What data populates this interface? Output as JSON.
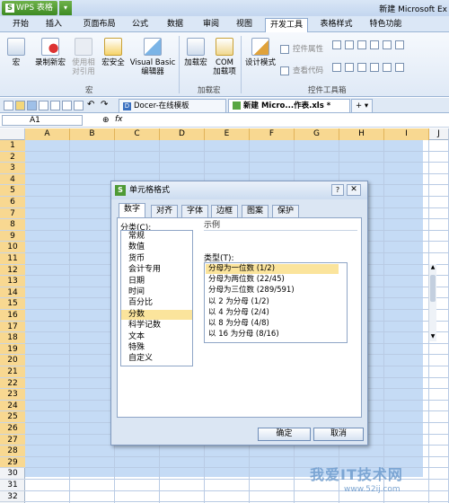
{
  "app": {
    "name": "WPS 表格",
    "logo_letter": "S",
    "window_title": "新建 Microsoft Ex"
  },
  "menu": [
    "开始",
    "插入",
    "页面布局",
    "公式",
    "数据",
    "审阅",
    "视图",
    "开发工具",
    "表格样式",
    "特色功能"
  ],
  "ribbon": {
    "buttons": [
      "宏",
      "录制新宏",
      "使用相\n对引用",
      "宏安全",
      "Visual Basic\n编辑器",
      "加载宏",
      "COM\n加载项",
      "设计模式"
    ],
    "small": [
      "控件属性",
      "查看代码"
    ],
    "groups": [
      "宏",
      "加载宏",
      "控件工具箱"
    ]
  },
  "doc_tabs": [
    "Docer-在线模板",
    "新建 Micro...作表.xls *"
  ],
  "formula_bar": {
    "cell_ref": "A1",
    "fx": "fx"
  },
  "columns": [
    "A",
    "B",
    "C",
    "D",
    "E",
    "F",
    "G",
    "H",
    "I",
    "J"
  ],
  "rows": [
    "1",
    "2",
    "3",
    "4",
    "5",
    "6",
    "7",
    "8",
    "9",
    "10",
    "11",
    "12",
    "13",
    "14",
    "15",
    "16",
    "17",
    "18",
    "19",
    "20",
    "21",
    "22",
    "23",
    "24",
    "25",
    "26",
    "27",
    "28",
    "29",
    "30",
    "31",
    "32"
  ],
  "dialog": {
    "title": "单元格格式",
    "icon_letter": "S",
    "help": "?",
    "close": "✕",
    "tabs": [
      "数字",
      "对齐",
      "字体",
      "边框",
      "图案",
      "保护"
    ],
    "category_label": "分类(C):",
    "categories": [
      "常规",
      "数值",
      "货币",
      "会计专用",
      "日期",
      "时间",
      "百分比",
      "分数",
      "科学记数",
      "文本",
      "特殊",
      "自定义"
    ],
    "selected_category": "分数",
    "sample_label": "示例",
    "type_label": "类型(T):",
    "types": [
      "分母为一位数 (1/2)",
      "分母为两位数 (22/45)",
      "分母为三位数 (289/591)",
      "以 2 为分母 (1/2)",
      "以 4 为分母 (2/4)",
      "以 8 为分母 (4/8)",
      "以 16 为分母 (8/16)"
    ],
    "selected_type": "分母为一位数 (1/2)",
    "ok": "确定",
    "cancel": "取消"
  },
  "watermark": {
    "text": "我爱IT技术网",
    "url": "www.52ij.com"
  }
}
